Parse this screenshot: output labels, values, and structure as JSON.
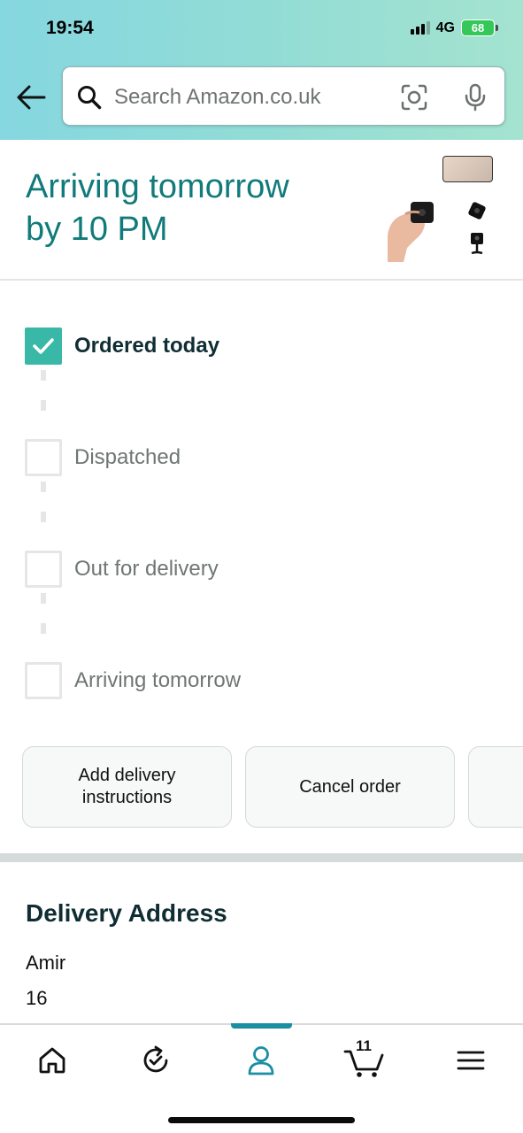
{
  "status_bar": {
    "time": "19:54",
    "network": "4G",
    "battery": "68"
  },
  "search": {
    "placeholder": "Search Amazon.co.uk"
  },
  "arrival": {
    "line1": "Arriving tomorrow",
    "line2": "by 10 PM"
  },
  "tracker": {
    "steps": [
      {
        "label": "Ordered today",
        "done": true
      },
      {
        "label": "Dispatched",
        "done": false
      },
      {
        "label": "Out for delivery",
        "done": false
      },
      {
        "label": "Arriving tomorrow",
        "done": false
      }
    ]
  },
  "actions": {
    "delivery_instructions_line1": "Add delivery",
    "delivery_instructions_line2": "instructions",
    "cancel": "Cancel order"
  },
  "address": {
    "heading": "Delivery Address",
    "name": "Amir",
    "line1": "16"
  },
  "bottom_nav": {
    "items": [
      "home-icon",
      "buy-again-icon",
      "account-icon",
      "cart-icon",
      "menu-icon"
    ],
    "cart_count": "11",
    "active": "account-icon"
  },
  "colors": {
    "accent_teal": "#117a7a",
    "check_teal": "#39b8a8",
    "nav_active": "#1a8ea3"
  }
}
